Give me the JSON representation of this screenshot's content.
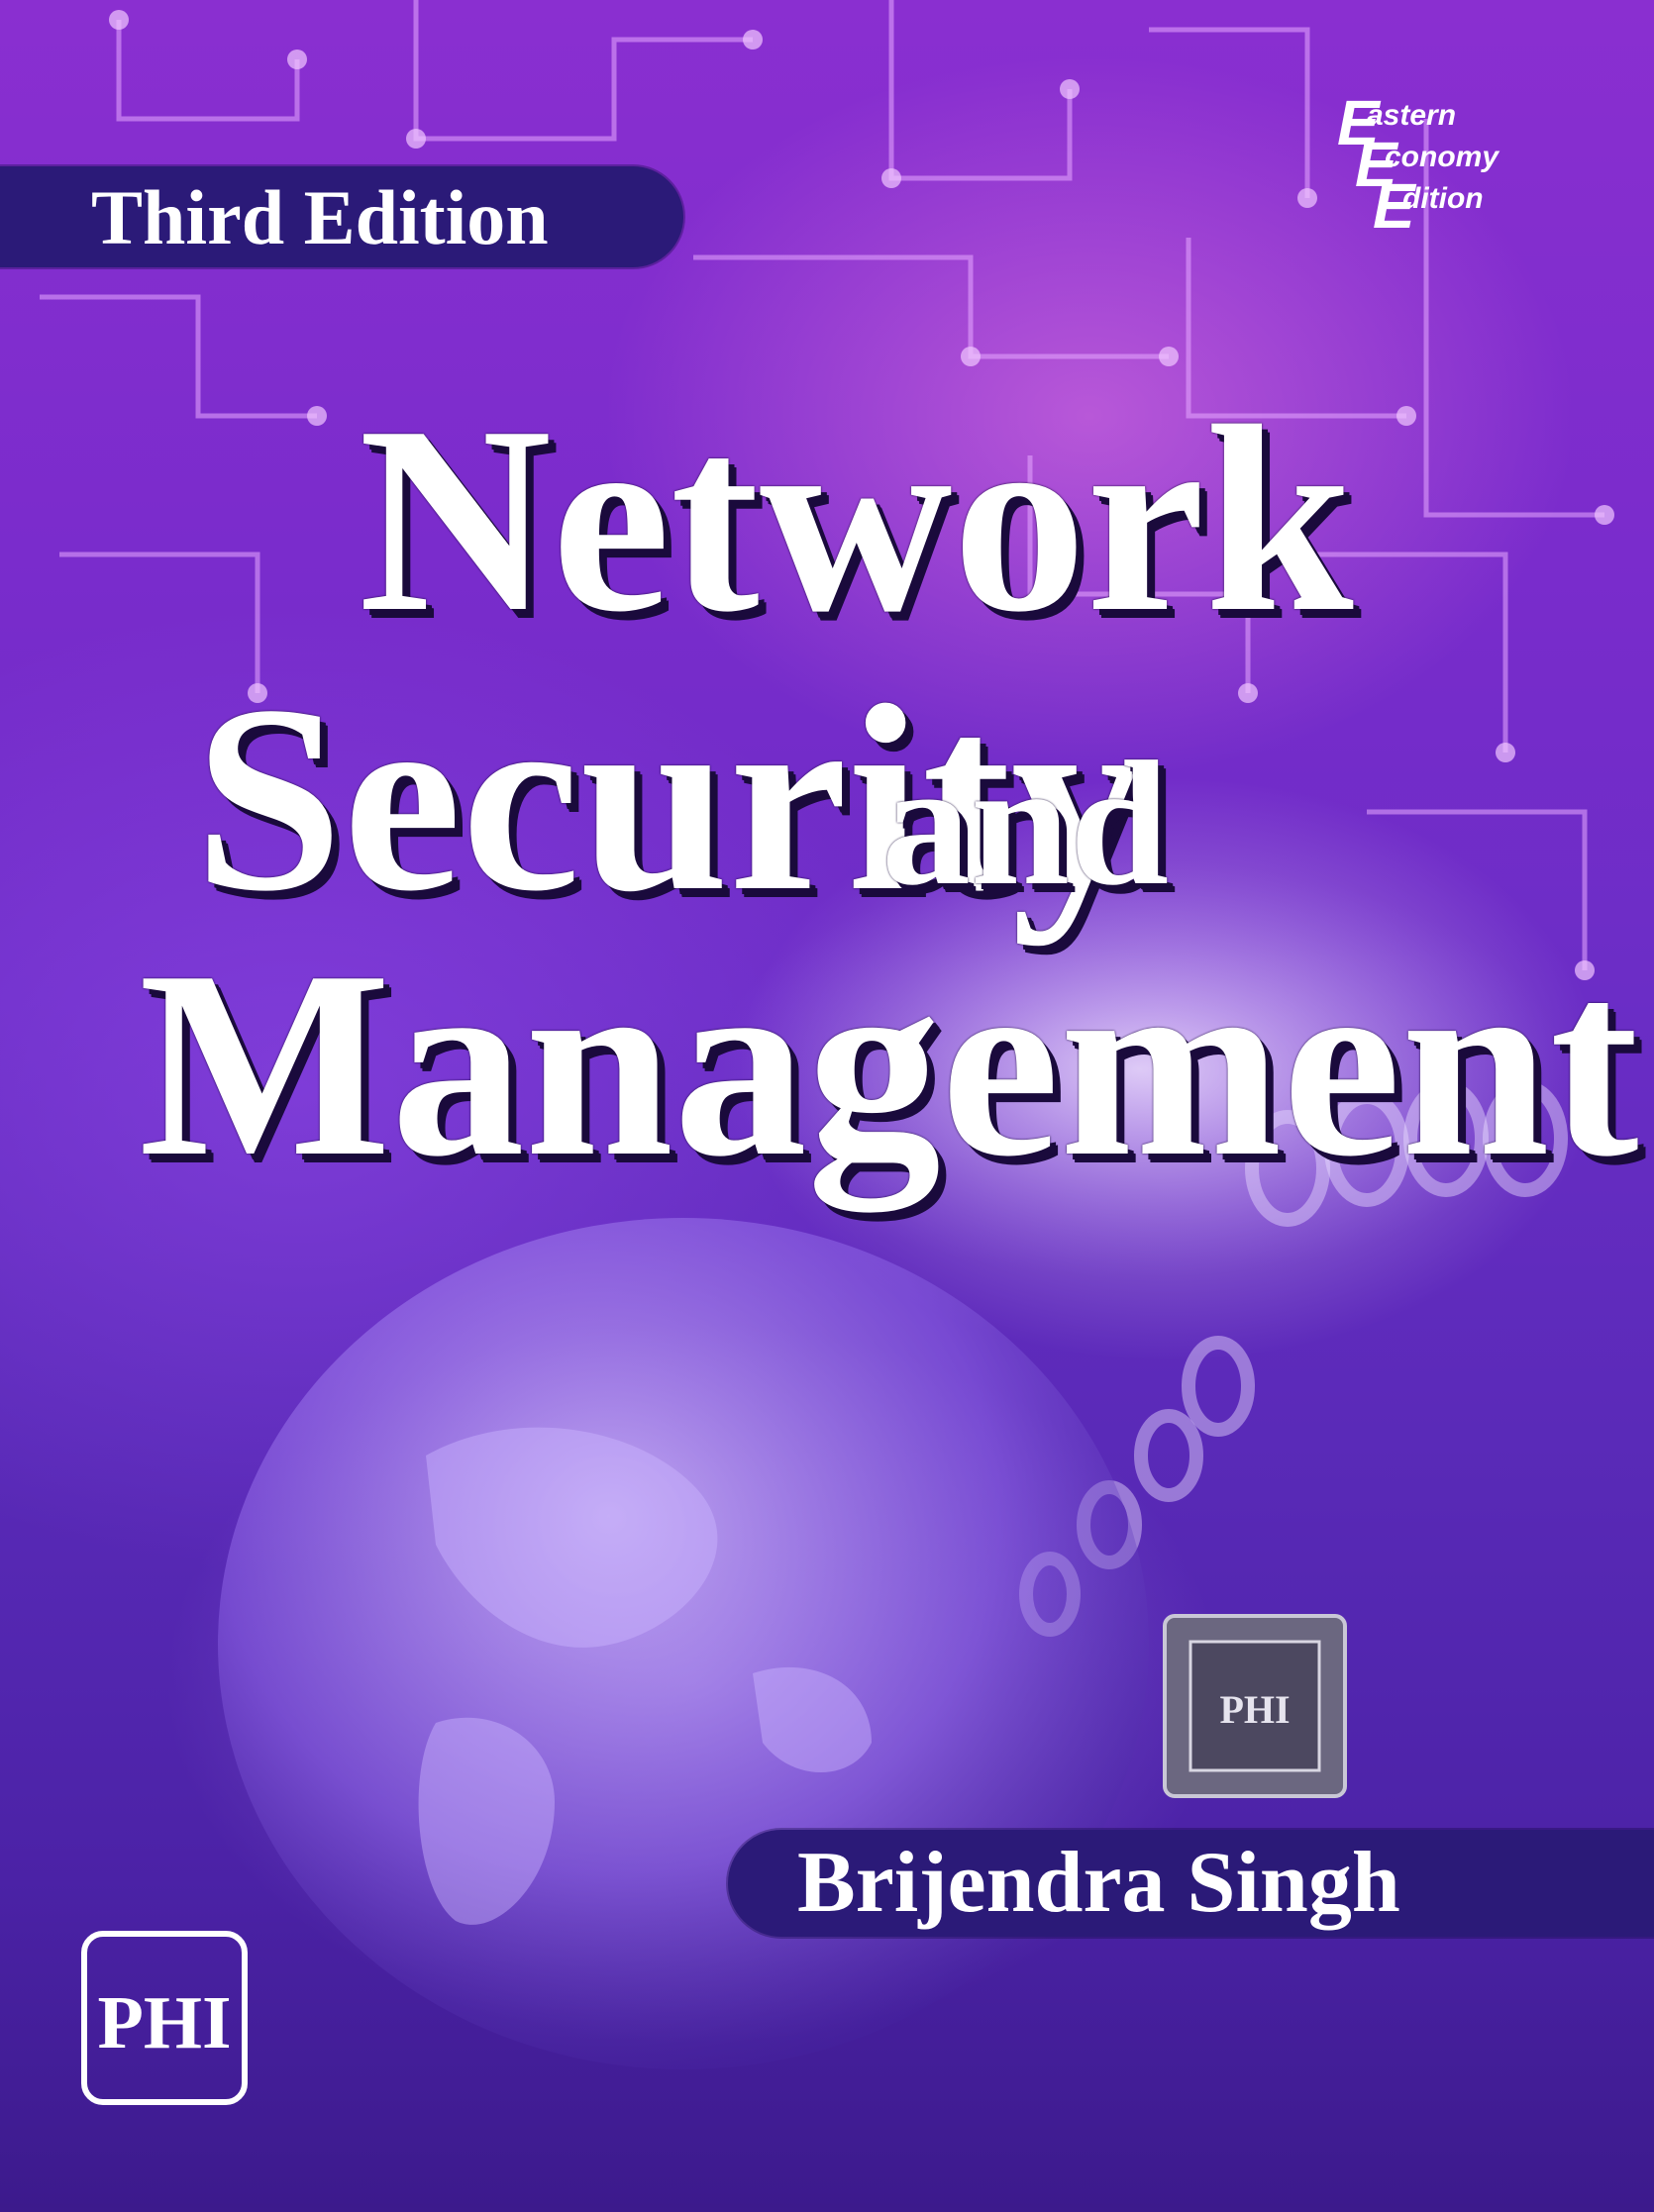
{
  "cover": {
    "edition_label": "Third Edition",
    "title_lines": [
      "Network",
      "Security",
      "and",
      "Management"
    ],
    "author": "Brijendra Singh",
    "series_mark": {
      "words": [
        "astern",
        "conomy",
        "dition"
      ],
      "initials": [
        "E",
        "E",
        "E"
      ],
      "full_text": "Eastern Economy Edition"
    },
    "publisher_logo_text": "PHI",
    "hologram_text": "PHI"
  },
  "colors": {
    "band": "#2b1a78",
    "title_fill": "#ffffff",
    "title_shadow": "#1a0a3c",
    "background_top": "#8a2fd0",
    "background_bottom": "#3c1a8c"
  },
  "icons": [
    "circuit-board-art",
    "globe-art",
    "hologram-seal-icon",
    "publisher-logo-icon",
    "series-logo-icon"
  ]
}
